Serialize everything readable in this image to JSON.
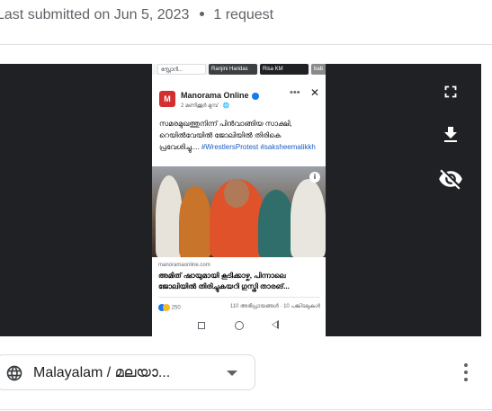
{
  "header": {
    "submitted_text": "Last submitted on Jun 5, 2023",
    "requests_text": "1 request"
  },
  "screenshot": {
    "stories": [
      "സ്റ്റോറി...",
      "Ranjini Haridas",
      "Risa KM",
      "bab"
    ],
    "post": {
      "page_name": "Manorama Online",
      "logo_text": "M",
      "time": "2 മണിക്കൂർ മുമ്പ് · 🌐",
      "text": "സമരമുഖത്തുനിന്ന് പിൻവാങ്ങിയ സാക്ഷി, റെയിൽവേയിൽ ജോലിയിൽ തിരികെ പ്രവേശിച്ചു....",
      "hashtags": "#WrestlersProtest #saksheemalikkh",
      "link_source": "manoramaonline.com",
      "link_title": "അമിത് ഷായുമായി കൂടിക്കാഴ്ച, പിന്നാലെ ജോലിയിൽ തിരിച്ചുകയറി ഗുസ്തി താരങ്...",
      "reaction_count": "250",
      "comments_shares": "110 അഭിപ്രായങ്ങൾ · 10 പങ്കിടലുകൾ"
    }
  },
  "viewer_controls": {
    "fullscreen_icon": "fullscreen-icon",
    "download_icon": "download-icon",
    "hide_icon": "visibility-off-icon"
  },
  "language_selector": {
    "selected": "Malayalam / മലയാ...",
    "icon": "globe-icon"
  },
  "colors": {
    "viewer_bg": "#202124",
    "brand_red": "#d32f2f",
    "link_blue": "#1a5bc4"
  }
}
